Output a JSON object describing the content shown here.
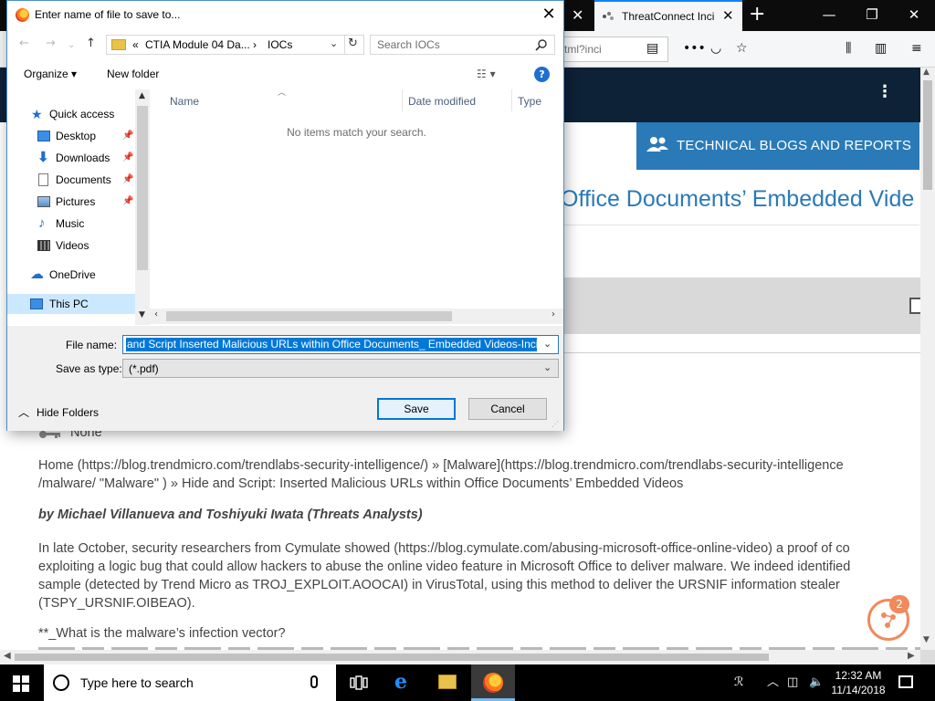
{
  "browser": {
    "active_tab_title": "ThreatConnect Inci",
    "url_fragment": "tml?inci",
    "site": {
      "menu_icon": "kebab-icon",
      "blogs_button_label": "TECHNICAL BLOGS AND REPORTS",
      "article_title_fragment": "Office Documents’ Embedded Vide",
      "content": {
        "tags_value": "None",
        "breadcrumb_line1": "Home (https://blog.trendmicro.com/trendlabs-security-intelligence/) » [Malware](https://blog.trendmicro.com/trendlabs-security-intelligence",
        "breadcrumb_line2": "/malware/ \"Malware\" ) » Hide and Script: Inserted Malicious URLs within Office Documents’ Embedded Videos",
        "byline": "by Michael Villanueva and Toshiyuki Iwata (Threats Analysts)",
        "para_line1": "In late October, security researchers from Cymulate showed (https://blog.cymulate.com/abusing-microsoft-office-online-video) a proof of co",
        "para_line2": "exploiting a logic bug that could allow hackers to abuse the online video feature in Microsoft Office to deliver malware. We indeed identified",
        "para_line3": "sample (detected by Trend Micro as TROJ_EXPLOIT.AOOCAI) in VirusTotal, using this method to deliver the URSNIF information stealer",
        "para_line4": "(TSPY_URSNIF.OIBEAO).",
        "question": "**_What is the malware’s infection vector?",
        "help_badge_count": "2"
      }
    }
  },
  "dialog": {
    "title": "Enter name of file to save to...",
    "path": {
      "overflow": "«",
      "segment1": "CTIA Module 04 Da...",
      "chevron": "›",
      "segment2": "IOCs"
    },
    "search_placeholder": "Search IOCs",
    "toolbar": {
      "organize_label": "Organize ▾",
      "new_folder_label": "New folder"
    },
    "nav": {
      "items": [
        {
          "label": "Quick access"
        },
        {
          "label": "Desktop"
        },
        {
          "label": "Downloads"
        },
        {
          "label": "Documents"
        },
        {
          "label": "Pictures"
        },
        {
          "label": "Music"
        },
        {
          "label": "Videos"
        },
        {
          "label": "OneDrive"
        },
        {
          "label": "This PC"
        }
      ]
    },
    "columns": {
      "name": "Name",
      "date_modified": "Date modified",
      "type": "Type"
    },
    "empty_message": "No items match your search.",
    "file_name_label": "File name:",
    "file_name_value": "and Script Inserted Malicious URLs within Office Documents_ Embedded Videos-Incid",
    "save_as_type_label": "Save as type:",
    "save_as_type_value": "(*.pdf)",
    "hide_folders_label": "Hide Folders",
    "save_label": "Save",
    "cancel_label": "Cancel"
  },
  "taskbar": {
    "search_placeholder": "Type here to search",
    "time": "12:32 AM",
    "date": "11/14/2018"
  },
  "colors": {
    "accent_blue": "#2a7ab8",
    "header_navy": "#0d2137",
    "selection": "#0078d7"
  }
}
